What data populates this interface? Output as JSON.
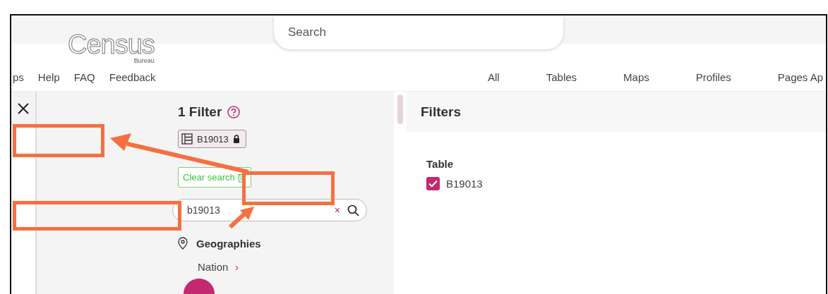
{
  "header": {
    "logo": "Census",
    "logo_sub": "Bureau",
    "search": {
      "placeholder": "Search"
    },
    "nav_left": [
      "ps",
      "Help",
      "FAQ",
      "Feedback"
    ],
    "nav_right": [
      "All",
      "Tables",
      "Maps",
      "Profiles",
      "Pages Ap"
    ]
  },
  "filter_panel": {
    "title": "1 Filter",
    "chips": [
      {
        "label": "B19013",
        "locked": true
      }
    ],
    "clear_button": "Clear search",
    "search": {
      "value": "b19013",
      "clear": "×"
    },
    "sections": [
      {
        "title": "Geographies",
        "items": [
          {
            "label": "Nation",
            "chevron": "›"
          }
        ]
      }
    ]
  },
  "filters_panel": {
    "title": "Filters",
    "groups": [
      {
        "title": "Table",
        "options": [
          {
            "label": "B19013",
            "checked": true
          }
        ]
      }
    ]
  }
}
